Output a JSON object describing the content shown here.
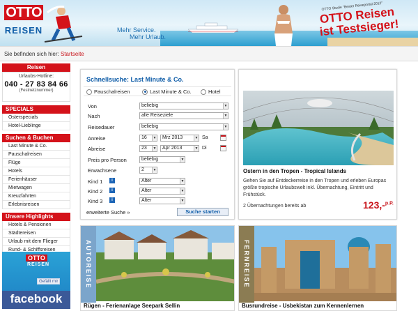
{
  "banner": {
    "logo_otto": "OTTO",
    "logo_reisen": "REISEN",
    "slogan_line1": "Mehr Service.",
    "slogan_line2": "Mehr Urlaub.",
    "test_small": "OTTO Studie \"Bester Reiseportal 2012\"",
    "test_line1": "OTTO Reisen",
    "test_line2": "ist Testsieger!"
  },
  "breadcrumb": {
    "prefix": "Sie befinden sich hier:",
    "current": "Startseite"
  },
  "sidebar": {
    "reisen_head": "Reisen",
    "hotline_caption": "Urlaubs-Hotline:",
    "hotline_number": "040 - 27 83 84 66",
    "hotline_sub": "(Festnetznummer)",
    "specials_head": "SPECIALS",
    "specials": [
      "Osterspecials",
      "Hotel-Lieblinge"
    ],
    "suchen_head": "Suchen & Buchen",
    "suchen": [
      "Last Minute & Co.",
      "Pauschalreisen",
      "Flüge",
      "Hotels",
      "Ferienhäuser",
      "Mietwagen",
      "Kreuzfahrten",
      "Erlebnisreisen"
    ],
    "highlights_head": "Unsere Highlights",
    "highlights": [
      "Hotels & Pensionen",
      "Städtereisen",
      "Urlaub mit dem Flieger",
      "Rund- & Schiffsreisen"
    ],
    "fb_otto": "OTTO",
    "fb_reisen": "REISEN",
    "fb_like": "Gefällt mir",
    "fb_word": "facebook"
  },
  "search": {
    "title": "Schnellsuche: Last Minute & Co.",
    "radio_pauschal": "Pauschalreisen",
    "radio_lastminute": "Last Minute & Co.",
    "radio_hotel": "Hotel",
    "labels": {
      "von": "Von",
      "nach": "Nach",
      "dauer": "Reisedauer",
      "anreise": "Anreise",
      "abreise": "Abreise",
      "preis": "Preis pro Person",
      "erw": "Erwachsene",
      "kind1": "Kind 1",
      "kind2": "Kind 2",
      "kind3": "Kind 3"
    },
    "values": {
      "von": "beliebig",
      "nach": "alle Reiseziele",
      "dauer": "beliebig",
      "anreise_day": "16",
      "anreise_month": "Mrz 2013",
      "anreise_wd": "Sa",
      "abreise_day": "23",
      "abreise_month": "Apr 2013",
      "abreise_wd": "Di",
      "preis": "beliebig",
      "erw": "2",
      "kind1": "Alter",
      "kind2": "Alter",
      "kind3": "Alter"
    },
    "extended_link": "erweiterte Suche »",
    "submit": "Suche starten"
  },
  "promo": {
    "title": "Ostern in den Tropen - Tropical Islands",
    "text": "Gehen Sie auf Entdeckerreise in den Tropen und erleben Europas größte tropische Urlaubswelt inkl. Übernachtung, Eintritt und Frühstück.",
    "note": "2 Übernachtungen bereits ab",
    "price": "123,-",
    "price_sup": "p.P."
  },
  "cards": [
    {
      "vlabel": "AUTOREISE",
      "caption": "Rügen - Ferienanlage Seepark Sellin"
    },
    {
      "vlabel": "FERNREISE",
      "caption": "Busrundreise - Usbekistan zum Kennenlernen"
    }
  ],
  "colors": {
    "brand_red": "#d4121a",
    "link_blue": "#0f5da8",
    "fb_blue": "#3b5998"
  }
}
